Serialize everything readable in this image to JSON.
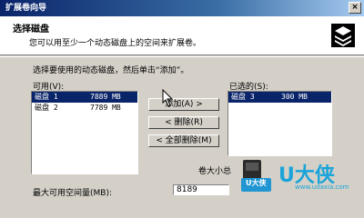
{
  "window": {
    "title": "扩展卷向导",
    "close_label": "×"
  },
  "header": {
    "title": "选择磁盘",
    "subtitle": "您可以用至少一个动态磁盘上的空间来扩展卷。",
    "icon": "disk-stack-icon"
  },
  "instruction": "选择要使用的动态磁盘，然后单击“添加”。",
  "available": {
    "label": "可用(V):",
    "rows": [
      {
        "name": "磁盘 1",
        "size": "7889 MB",
        "selected": true
      },
      {
        "name": "磁盘 2",
        "size": "7789 MB",
        "selected": false
      }
    ]
  },
  "selected_list": {
    "label": "已选的(S):",
    "rows": [
      {
        "name": "磁盘 3",
        "size": "300 MB",
        "selected": true
      }
    ]
  },
  "buttons": {
    "add": "添加(A) >",
    "remove": "< 删除(R)",
    "remove_all": "< 全部删除(M)"
  },
  "volume_size": {
    "label": "卷大小总"
  },
  "max_space": {
    "label": "最大可用空间量(MB):",
    "value": "8189"
  },
  "watermark": {
    "brand": "U大侠",
    "icon_text": "U大侠",
    "url": "www.udaxia.com"
  }
}
